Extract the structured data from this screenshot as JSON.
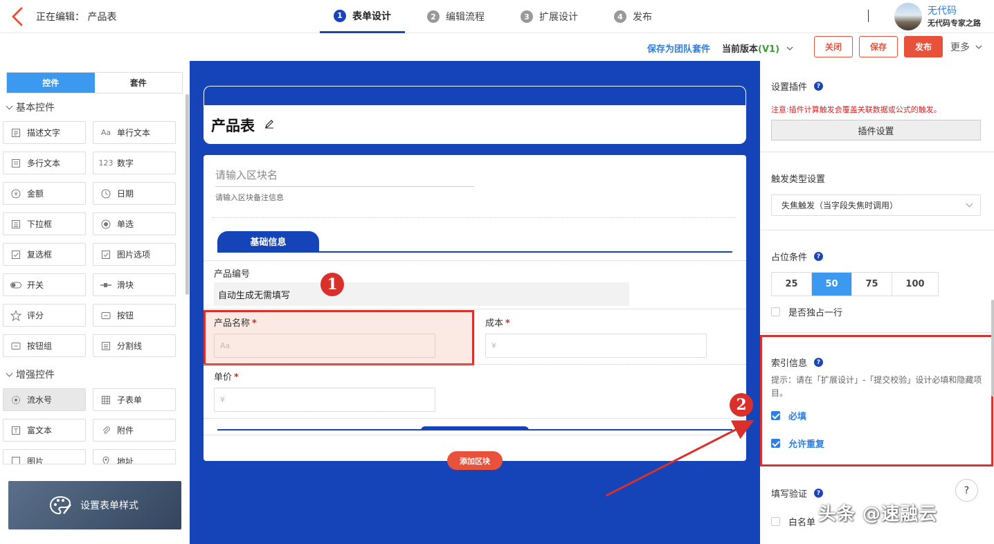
{
  "header": {
    "editing_label": "正在编辑： 产品表",
    "steps": [
      {
        "num": "1",
        "label": "表单设计"
      },
      {
        "num": "2",
        "label": "编辑流程"
      },
      {
        "num": "3",
        "label": "扩展设计"
      },
      {
        "num": "4",
        "label": "发布"
      }
    ],
    "user_name": "无代码",
    "user_sub": "无代码专家之路"
  },
  "toolbar": {
    "save_team": "保存为团队套件",
    "version_label": "当前版本",
    "version_value": "(V1)",
    "close_label": "关闭",
    "save_label": "保存",
    "publish_label": "发布",
    "more_label": "更多"
  },
  "left": {
    "tabs": [
      "控件",
      "套件"
    ],
    "basic_title": "基本控件",
    "basic": [
      "描述文字",
      "单行文本",
      "多行文本",
      "数字",
      "金额",
      "日期",
      "下拉框",
      "单选",
      "复选框",
      "图片选项",
      "开关",
      "滑块",
      "评分",
      "按钮",
      "按钮组",
      "分割线"
    ],
    "enhanced_title": "增强控件",
    "enhanced": [
      "流水号",
      "子表单",
      "富文本",
      "附件",
      "图片",
      "地址"
    ],
    "style_label": "设置表单样式"
  },
  "canvas": {
    "form_title": "产品表",
    "block_name_placeholder": "请输入区块名",
    "block_note_placeholder": "请输入区块备注信息",
    "tab_label": "基础信息",
    "fields": {
      "product_no_label": "产品编号",
      "product_no_value": "自动生成无需填写",
      "product_name_label": "产品名称",
      "product_name_placeholder": "Aa",
      "cost_label": "成本",
      "cost_placeholder": "¥",
      "price_label": "单价",
      "price_placeholder": "¥",
      "required_mark": "*"
    },
    "add_block": "添加区块",
    "marker1": "1",
    "marker2": "2"
  },
  "right": {
    "plugin_title": "设置插件",
    "plugin_note": "注意:插件计算触发会覆盖关联数据或公式的触发。",
    "plugin_btn": "插件设置",
    "trigger_title": "触发类型设置",
    "trigger_value": "失焦触发（当字段失焦时调用）",
    "placeholder_title": "占位条件",
    "widths": [
      "25",
      "50",
      "75",
      "100"
    ],
    "width_selected": "50",
    "exclusive_row": "是否独占一行",
    "index_title": "索引信息",
    "index_hint": "提示：请在「扩展设计」-「提交校验」设计必填和隐藏项目。",
    "required": "必填",
    "allow_dup": "允许重复",
    "validate_title": "填写验证",
    "whitelist": "白名单"
  },
  "watermark": "头条 @速融云",
  "colors": {
    "brand_blue": "#1444b8",
    "accent_orange": "#e8513a",
    "link_blue": "#2f7ee0",
    "annotation_red": "#d9302c"
  }
}
